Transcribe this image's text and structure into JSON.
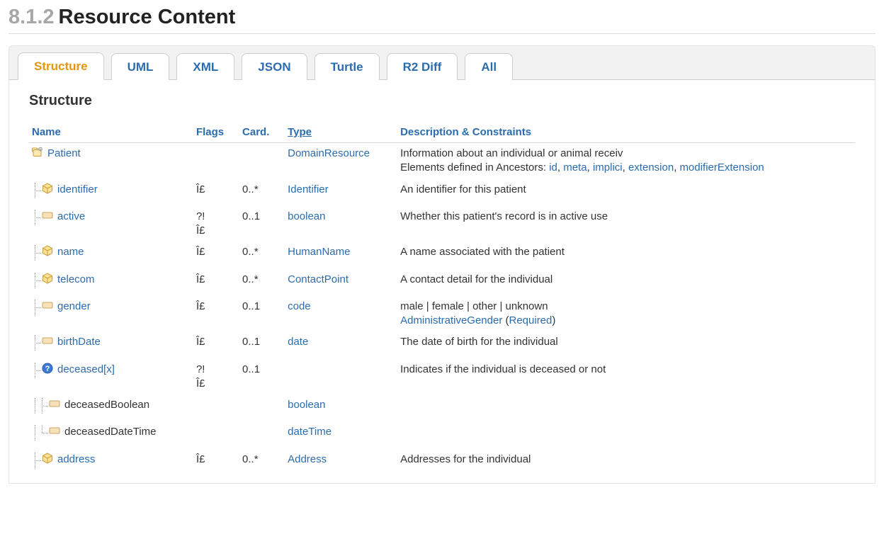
{
  "heading": {
    "section": "8.1.2",
    "title": "Resource Content"
  },
  "tabs": [
    "Structure",
    "UML",
    "XML",
    "JSON",
    "Turtle",
    "R2 Diff",
    "All"
  ],
  "activeTab": 0,
  "subheading": "Structure",
  "columns": {
    "name": "Name",
    "flags": "Flags",
    "card": "Card.",
    "type": "Type",
    "desc": "Description & Constraints"
  },
  "ancestorsPrefix": "Elements defined in Ancestors: ",
  "rows": [
    {
      "indent": 0,
      "icon": "resource",
      "joint": "none",
      "name": "Patient",
      "nameLink": true,
      "flags": "",
      "card": "",
      "type": "DomainResource",
      "desc": "Information about an individual or animal receiv",
      "ancestors": [
        "id",
        "meta",
        "implici",
        "extension",
        "modifierExtension"
      ]
    },
    {
      "indent": 1,
      "icon": "datatype",
      "joint": "mid",
      "name": "identifier",
      "nameLink": true,
      "flags": "Î£",
      "card": "0..*",
      "type": "Identifier",
      "desc": "An identifier for this patient"
    },
    {
      "indent": 1,
      "icon": "primitive",
      "joint": "mid",
      "name": "active",
      "nameLink": true,
      "flags": "?!\nÎ£",
      "card": "0..1",
      "type": "boolean",
      "desc": "Whether this patient's record is in active use"
    },
    {
      "indent": 1,
      "icon": "datatype",
      "joint": "mid",
      "name": "name",
      "nameLink": true,
      "flags": "Î£",
      "card": "0..*",
      "type": "HumanName",
      "desc": "A name associated with the patient"
    },
    {
      "indent": 1,
      "icon": "datatype",
      "joint": "mid",
      "name": "telecom",
      "nameLink": true,
      "flags": "Î£",
      "card": "0..*",
      "type": "ContactPoint",
      "desc": "A contact detail for the individual"
    },
    {
      "indent": 1,
      "icon": "primitive",
      "joint": "mid",
      "name": "gender",
      "nameLink": true,
      "flags": "Î£",
      "card": "0..1",
      "type": "code",
      "desc": "male | female | other | unknown",
      "binding": {
        "name": "AdministrativeGender",
        "strength": "Required"
      }
    },
    {
      "indent": 1,
      "icon": "primitive",
      "joint": "mid",
      "name": "birthDate",
      "nameLink": true,
      "flags": "Î£",
      "card": "0..1",
      "type": "date",
      "desc": "The date of birth for the individual"
    },
    {
      "indent": 1,
      "icon": "choice",
      "joint": "mid",
      "name": "deceased[x]",
      "nameLink": true,
      "flags": "?!\nÎ£",
      "card": "0..1",
      "type": "",
      "desc": "Indicates if the individual is deceased or not"
    },
    {
      "indent": 2,
      "icon": "primitive",
      "joint": "mid",
      "name": "deceasedBoolean",
      "nameLink": false,
      "flags": "",
      "card": "",
      "type": "boolean",
      "desc": ""
    },
    {
      "indent": 2,
      "icon": "primitive",
      "joint": "last",
      "name": "deceasedDateTime",
      "nameLink": false,
      "flags": "",
      "card": "",
      "type": "dateTime",
      "desc": ""
    },
    {
      "indent": 1,
      "icon": "datatype",
      "joint": "mid",
      "name": "address",
      "nameLink": true,
      "flags": "Î£",
      "card": "0..*",
      "type": "Address",
      "desc": "Addresses for the individual"
    }
  ]
}
